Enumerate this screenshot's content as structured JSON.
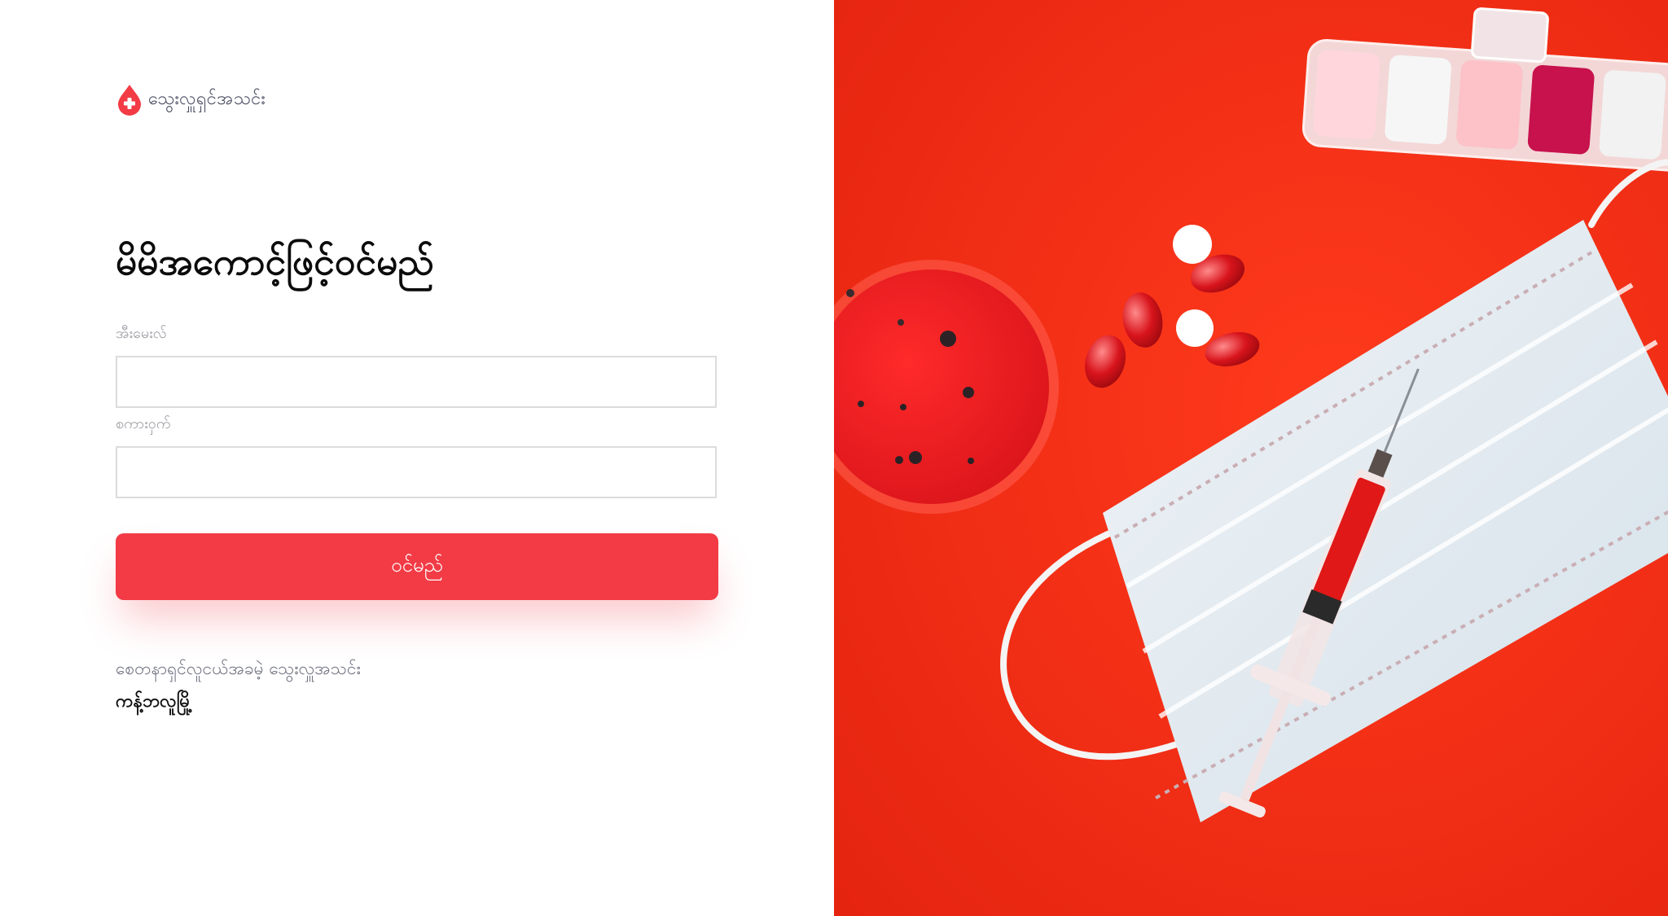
{
  "brand": {
    "name": "သွေးလှူရှင်အသင်း",
    "icon": "blood-drop-cross-icon",
    "color": "#f23b45"
  },
  "login_form": {
    "title": "မိမိအကောင့်ဖြင့်ဝင်မည်",
    "email_label": "အီးမေးလ်",
    "email_value": "",
    "password_label": "စကားဝှက်",
    "password_value": "",
    "submit_label": "ဝင်မည်"
  },
  "signup": {
    "prompt": "စေတနာရှင်လူငယ်အခမဲ့ သွေးလှူအသင်း",
    "link_label": "ကန့်ဘလူမြို့"
  },
  "colors": {
    "accent": "#f23b45",
    "hero_background": "#f22b14"
  }
}
